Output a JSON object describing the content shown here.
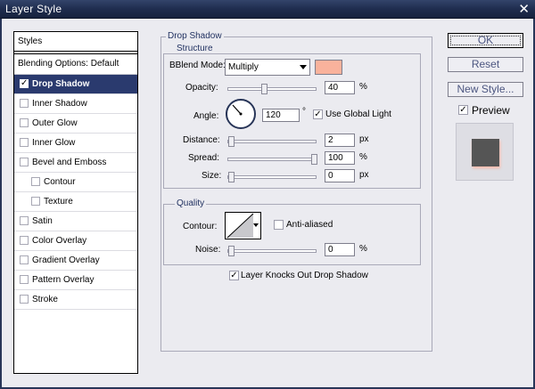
{
  "window": {
    "title": "Layer Style"
  },
  "styles_list": {
    "header": "Styles",
    "blending": "Blending Options: Default",
    "items": [
      {
        "label": "Drop Shadow",
        "checked": true,
        "active": true,
        "indent": false
      },
      {
        "label": "Inner Shadow",
        "checked": false,
        "active": false,
        "indent": false
      },
      {
        "label": "Outer Glow",
        "checked": false,
        "active": false,
        "indent": false
      },
      {
        "label": "Inner Glow",
        "checked": false,
        "active": false,
        "indent": false
      },
      {
        "label": "Bevel and Emboss",
        "checked": false,
        "active": false,
        "indent": false
      },
      {
        "label": "Contour",
        "checked": false,
        "active": false,
        "indent": true
      },
      {
        "label": "Texture",
        "checked": false,
        "active": false,
        "indent": true
      },
      {
        "label": "Satin",
        "checked": false,
        "active": false,
        "indent": false
      },
      {
        "label": "Color Overlay",
        "checked": false,
        "active": false,
        "indent": false
      },
      {
        "label": "Gradient Overlay",
        "checked": false,
        "active": false,
        "indent": false
      },
      {
        "label": "Pattern Overlay",
        "checked": false,
        "active": false,
        "indent": false
      },
      {
        "label": "Stroke",
        "checked": false,
        "active": false,
        "indent": false
      }
    ]
  },
  "drop_shadow": {
    "group_title": "Drop Shadow",
    "structure_title": "Structure",
    "blend_mode": {
      "label": "Blend Mode:",
      "value": "Multiply",
      "color": "#f9b29c"
    },
    "opacity": {
      "label": "Opacity:",
      "value": "40",
      "unit": "%",
      "fraction": 0.4
    },
    "angle": {
      "label": "Angle:",
      "value": "120",
      "unit": "°",
      "global_light_label": "Use Global Light",
      "global_light_checked": true
    },
    "distance": {
      "label": "Distance:",
      "value": "2",
      "unit": "px",
      "fraction": 0.0
    },
    "spread": {
      "label": "Spread:",
      "value": "100",
      "unit": "%",
      "fraction": 1.0
    },
    "size": {
      "label": "Size:",
      "value": "0",
      "unit": "px",
      "fraction": 0.0
    },
    "quality_title": "Quality",
    "contour": {
      "label": "Contour:",
      "anti_aliased_label": "Anti-aliased",
      "anti_aliased_checked": false
    },
    "noise": {
      "label": "Noise:",
      "value": "0",
      "unit": "%",
      "fraction": 0.0
    },
    "knockout": {
      "label": "Layer Knocks Out Drop Shadow",
      "checked": true
    }
  },
  "buttons": {
    "ok": "OK",
    "reset": "Reset",
    "new_style": "New Style...",
    "preview_label": "Preview",
    "preview_checked": true
  }
}
